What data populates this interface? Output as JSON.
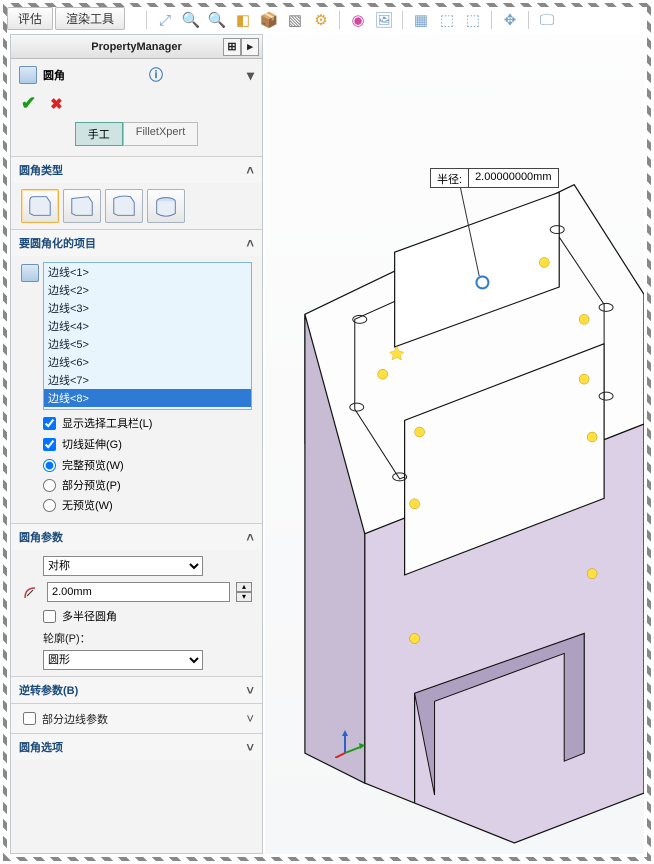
{
  "menubar": {
    "eval": "评估",
    "render": "渲染工具"
  },
  "pm_title": "PropertyManager",
  "feature_title": "圆角",
  "tabs": {
    "manual": "手工",
    "xpert": "FilletXpert"
  },
  "sections": {
    "type": "圆角类型",
    "items": "要圆角化的项目",
    "params": "圆角参数",
    "reverse": "逆转参数(B)",
    "partial": "部分边线参数",
    "options": "圆角选项"
  },
  "edges": [
    "边线<1>",
    "边线<2>",
    "边线<3>",
    "边线<4>",
    "边线<5>",
    "边线<6>",
    "边线<7>",
    "边线<8>"
  ],
  "checks": {
    "show_toolbar": "显示选择工具栏(L)",
    "tangent": "切线延伸(G)",
    "multi": "多半径圆角"
  },
  "radios": {
    "full": "完整预览(W)",
    "partial": "部分预览(P)",
    "none": "无预览(W)"
  },
  "combos": {
    "sym": "对称",
    "profile_label": "轮廓(P)：",
    "profile": "圆形"
  },
  "radius": "2.00mm",
  "callout": {
    "label": "半径:",
    "value": "2.00000000mm"
  }
}
